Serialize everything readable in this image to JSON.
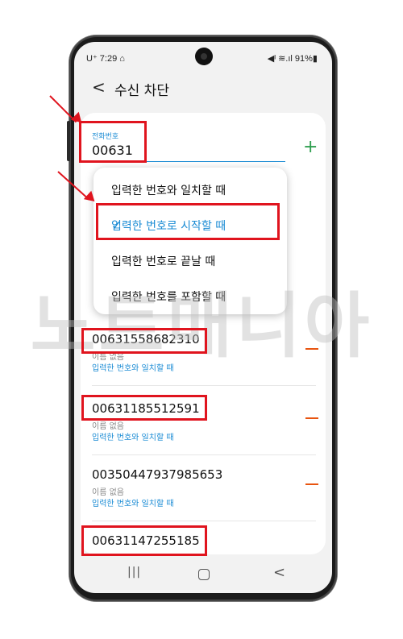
{
  "status_bar": {
    "time": "U⁺ 7:29 ⌂",
    "right": "◀ᴵ ≋.ıl 91%▮"
  },
  "header": {
    "title": "수신 차단"
  },
  "input": {
    "label": "전화번호",
    "value": "00631"
  },
  "dropdown": {
    "items": [
      {
        "label": "입력한 번호와 일치할 때"
      },
      {
        "label": "입력한 번호로 시작할 때",
        "selected": true
      },
      {
        "label": "입력한 번호로 끝날 때"
      },
      {
        "label": "입력한 번호를 포함할 때"
      }
    ]
  },
  "entries": [
    {
      "number": "00631558682310",
      "name": "이름 없음",
      "mode": "입력한 번호와 일치할 때"
    },
    {
      "number": "00631185512591",
      "name": "이름 없음",
      "mode": "입력한 번호와 일치할 때"
    },
    {
      "number": "00350447937985653",
      "name": "이름 없음",
      "mode": "입력한 번호와 일치할 때"
    },
    {
      "number": "00631147255185"
    }
  ],
  "watermark": "노트매니아",
  "colors": {
    "accent": "#1a8bd4",
    "add": "#2e9e4f",
    "remove": "#e8540f",
    "highlight": "#e0141e"
  }
}
